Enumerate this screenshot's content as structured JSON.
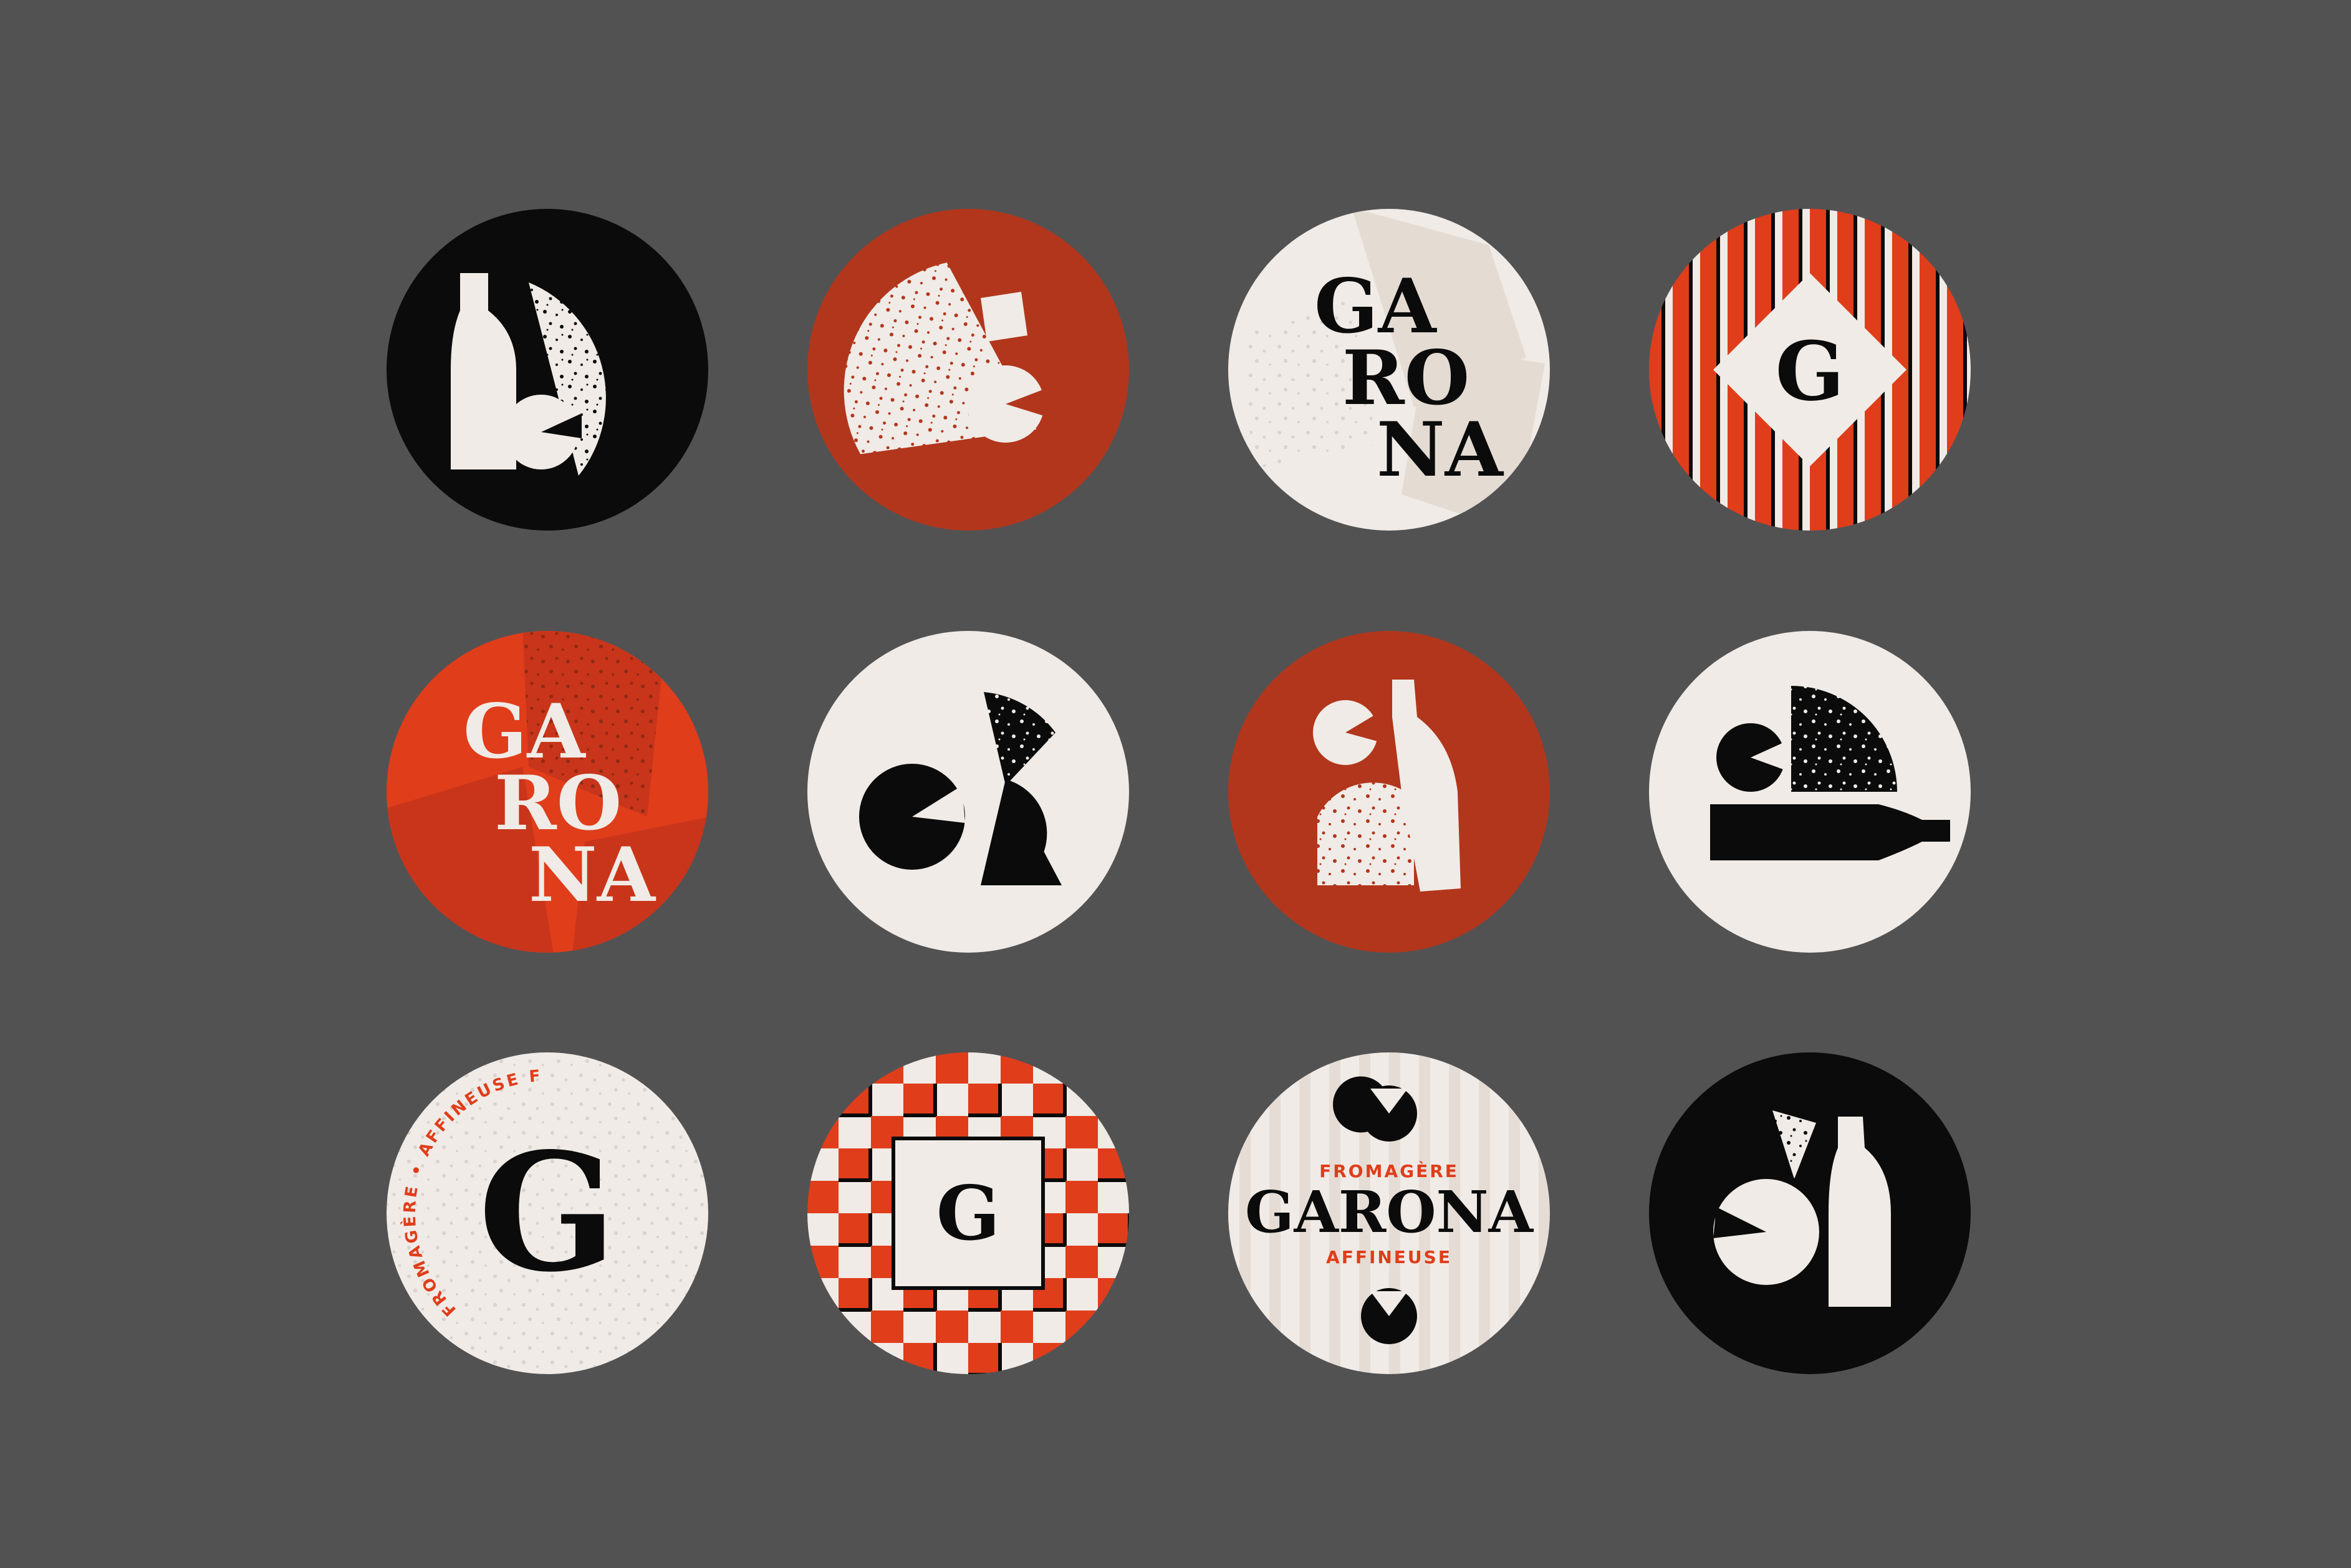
{
  "brand": {
    "name": "GARONA",
    "syllables": [
      "GA",
      "RO",
      "NA"
    ],
    "monogram": "G",
    "top_label": "FROMAGÈRE",
    "bottom_label": "AFFINEUSE",
    "ring_text": "FROMAGÈRE • AFFINEUSE    FROMAGERIE CRÈMERIE ÉPICERIE FINE"
  },
  "colors": {
    "background": "#535253",
    "black": "#0b0b0b",
    "cream": "#f0ebe6",
    "rust": "#b2361c",
    "red": "#e03d1b",
    "speckle": "#d9d3cd"
  },
  "stickers": [
    {
      "name": "sticker-bottle-cheese-black",
      "background": "black"
    },
    {
      "name": "sticker-cheese-wedge-rust",
      "background": "rust"
    },
    {
      "name": "sticker-wordmark-stacked-cream",
      "background": "cream"
    },
    {
      "name": "sticker-monogram-stripes",
      "background": "red-stripes"
    },
    {
      "name": "sticker-wordmark-stacked-red",
      "background": "red"
    },
    {
      "name": "sticker-shapes-cream",
      "background": "cream"
    },
    {
      "name": "sticker-cheese-bottle-rust",
      "background": "rust"
    },
    {
      "name": "sticker-bottle-lying-cream",
      "background": "cream"
    },
    {
      "name": "sticker-monogram-ring-text",
      "background": "cream"
    },
    {
      "name": "sticker-monogram-checkered",
      "background": "red-checker"
    },
    {
      "name": "sticker-wordmark-horizontal",
      "background": "cream-stripes"
    },
    {
      "name": "sticker-bottle-cheese-black-2",
      "background": "black"
    }
  ]
}
